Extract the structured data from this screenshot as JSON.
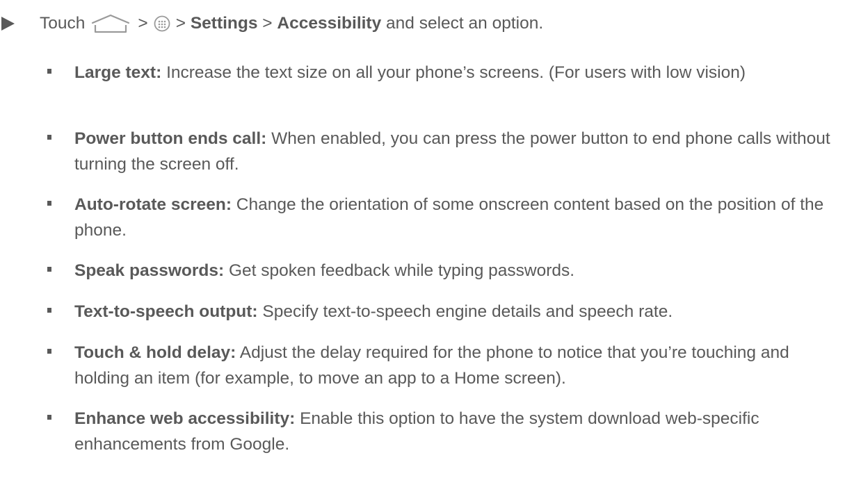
{
  "instruction": {
    "touch": "Touch",
    "sep1": ">",
    "sep2": ">",
    "settings": "Settings",
    "sep3": ">",
    "accessibility": "Accessibility",
    "tail": "and select an option."
  },
  "icons": {
    "home": "home-icon",
    "apps": "apps-icon",
    "bullet": "triangle-bullet-icon"
  },
  "options": [
    {
      "label": "Large text:",
      "desc": "Increase the text size on all your phone’s screens. (For users with low vision)"
    },
    {
      "label": "Power button ends call:",
      "desc": "When enabled, you can press the power button to end phone calls without turning the screen off."
    },
    {
      "label": "Auto-rotate screen:",
      "desc": "Change the orientation of some onscreen content based on the position of the phone."
    },
    {
      "label": "Speak passwords:",
      "desc": "Get spoken feedback while typing passwords."
    },
    {
      "label": "Text-to-speech output:",
      "desc": "Specify text-to-speech engine details and speech rate."
    },
    {
      "label": "Touch & hold delay:",
      "desc": "Adjust the delay required for the phone to notice that you’re touching and holding an item (for example, to move an app to a Home screen)."
    },
    {
      "label": "Enhance web accessibility:",
      "desc": "Enable this option to have the system download web-specific enhancements from Google."
    }
  ]
}
